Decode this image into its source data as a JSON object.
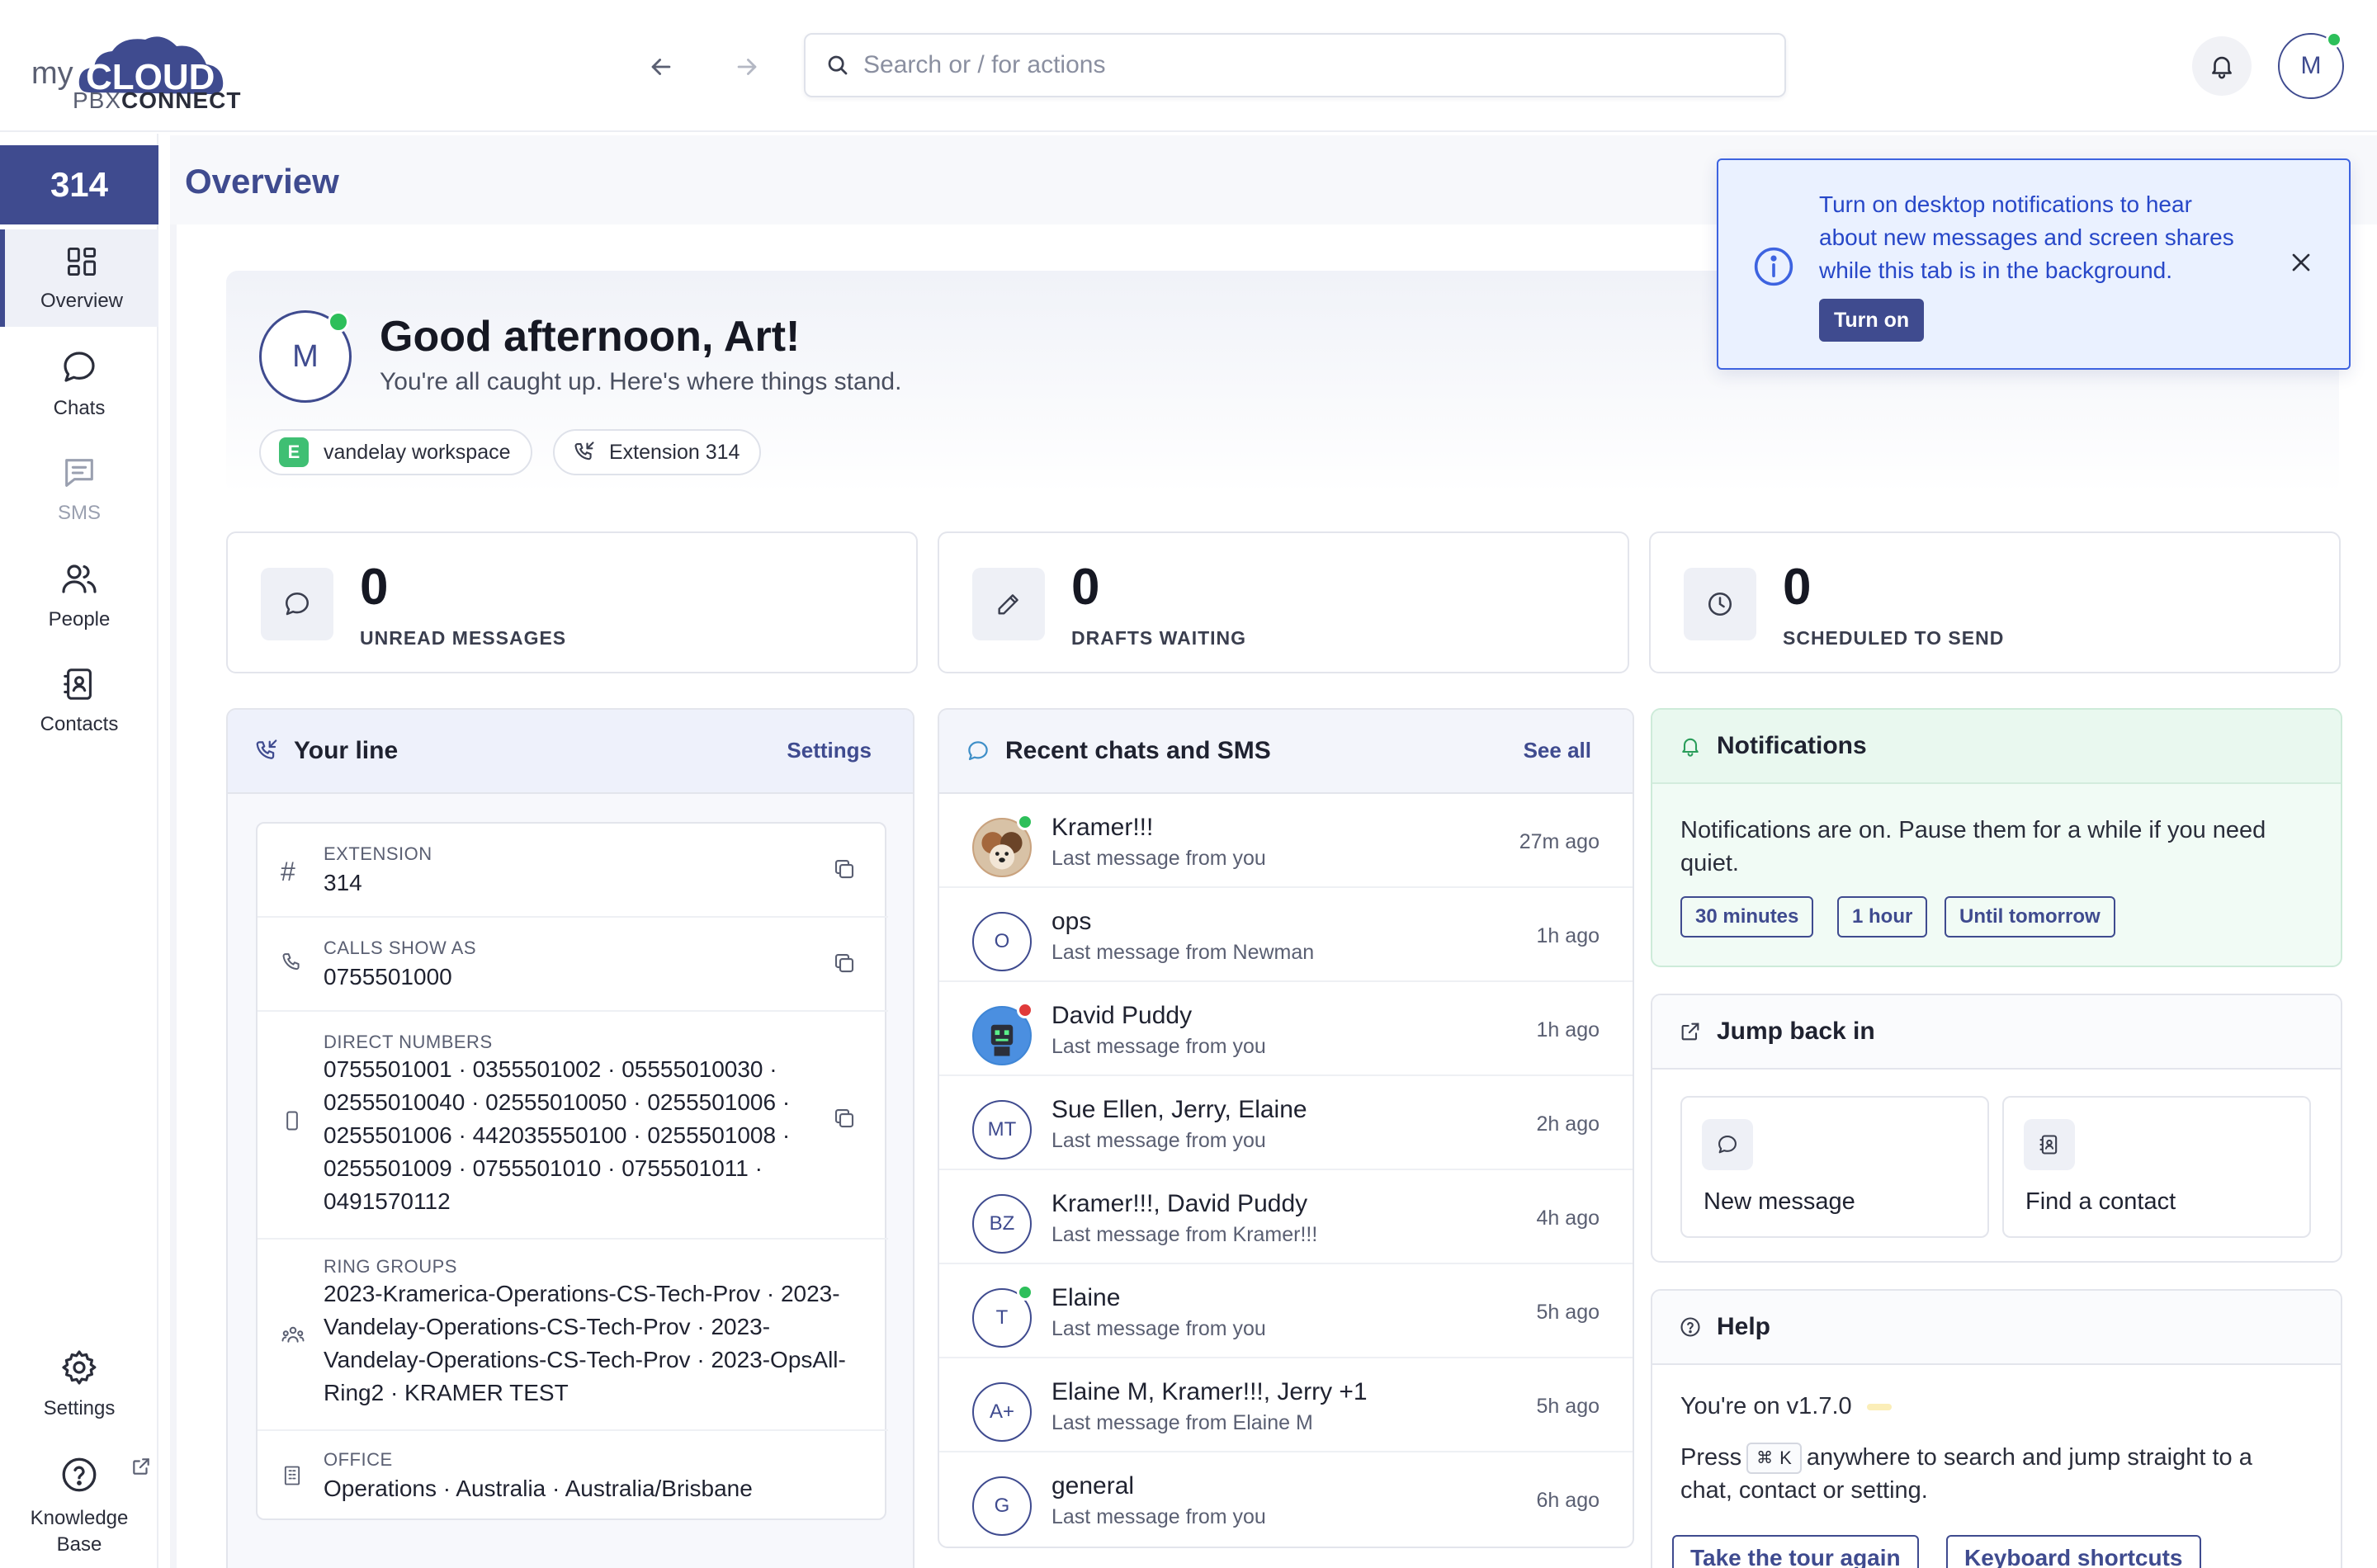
{
  "brand": {
    "my": "my",
    "cloud": "CLOUD",
    "pbx": "PBX",
    "connect": "CONNECT"
  },
  "search": {
    "placeholder": "Search or / for actions"
  },
  "user": {
    "initial": "M"
  },
  "sidebar": {
    "extension": "314",
    "items": [
      {
        "label": "Overview",
        "icon": "overview-grid-icon",
        "active": true
      },
      {
        "label": "Chats",
        "icon": "chat-bubble-icon"
      },
      {
        "label": "SMS",
        "icon": "sms-icon",
        "muted": true
      },
      {
        "label": "People",
        "icon": "people-icon"
      },
      {
        "label": "Contacts",
        "icon": "contacts-book-icon"
      }
    ],
    "bottom": [
      {
        "label": "Settings",
        "icon": "gear-icon"
      },
      {
        "label_line1": "Knowledge",
        "label_line2": "Base",
        "icon": "help-circle-icon"
      }
    ]
  },
  "page": {
    "title": "Overview"
  },
  "hero": {
    "greeting": "Good afternoon, Art!",
    "subtitle": "You're all caught up. Here's where things stand.",
    "workspace_initial": "E",
    "workspace": "vandelay workspace",
    "extension_chip": "Extension 314"
  },
  "stats": [
    {
      "value": "0",
      "label": "UNREAD MESSAGES",
      "icon": "chat-bubble-icon"
    },
    {
      "value": "0",
      "label": "DRAFTS WAITING",
      "icon": "pencil-icon"
    },
    {
      "value": "0",
      "label": "SCHEDULED TO SEND",
      "icon": "clock-icon"
    }
  ],
  "your_line": {
    "title": "Your line",
    "settings_link": "Settings",
    "extension_caption": "EXTENSION",
    "extension_value": "314",
    "calls_caption": "CALLS SHOW AS",
    "calls_value": "0755501000",
    "direct_caption": "DIRECT NUMBERS",
    "direct_lines": [
      "0755501001 · 0355501002 · 05555010030 ·",
      "02555010040 · 02555010050 · 0255501006 ·",
      "0255501006 · 442035550100 · 0255501008 ·",
      "0255501009 · 0755501010 · 0755501011 ·",
      "0491570112"
    ],
    "ring_caption": "RING GROUPS",
    "ring_lines": [
      "2023-Kramerica-Operations-CS-Tech-Prov · 2023-",
      "Vandelay-Operations-CS-Tech-Prov · 2023-",
      "Vandelay-Operations-CS-Tech-Prov · 2023-OpsAll-",
      "Ring2 · KRAMER TEST"
    ],
    "office_caption": "OFFICE",
    "office_value": "Operations · Australia · Australia/Brisbane"
  },
  "recent": {
    "title": "Recent chats and SMS",
    "see_all": "See all",
    "rows": [
      {
        "name": "Kramer!!!",
        "sub": "Last message from you",
        "time": "27m ago",
        "avatar": "",
        "status": "online"
      },
      {
        "name": "ops",
        "sub": "Last message from Newman",
        "time": "1h ago",
        "avatar": "O"
      },
      {
        "name": "David Puddy",
        "sub": "Last message from you",
        "time": "1h ago",
        "avatar": "",
        "status": "busy"
      },
      {
        "name": "Sue Ellen, Jerry, Elaine",
        "sub": "Last message from you",
        "time": "2h ago",
        "avatar": "MT"
      },
      {
        "name": "Kramer!!!, David Puddy",
        "sub": "Last message from Kramer!!!",
        "time": "4h ago",
        "avatar": "BZ"
      },
      {
        "name": "Elaine",
        "sub": "Last message from you",
        "time": "5h ago",
        "avatar": "T",
        "status": "online"
      },
      {
        "name": "Elaine M, Kramer!!!, Jerry +1",
        "sub": "Last message from Elaine M",
        "time": "5h ago",
        "avatar": "A+"
      },
      {
        "name": "general",
        "sub": "Last message from you",
        "time": "6h ago",
        "avatar": "G"
      }
    ]
  },
  "notifications": {
    "title": "Notifications",
    "text_line1": "Notifications are on. Pause them for a while if you need",
    "text_line2": "quiet.",
    "options": [
      "30 minutes",
      "1 hour",
      "Until tomorrow"
    ]
  },
  "jump": {
    "title": "Jump back in",
    "tiles": [
      {
        "label": "New message",
        "icon": "chat-bubble-icon"
      },
      {
        "label": "Find a contact",
        "icon": "contacts-book-icon"
      }
    ]
  },
  "help": {
    "title": "Help",
    "version": "You're on v1.7.0",
    "press": "Press",
    "key_symbol": "⌘",
    "key": "K",
    "press_rest": "anywhere to search and jump straight to a",
    "press_line2": "chat, contact or setting.",
    "buttons": [
      "Take the tour again",
      "Keyboard shortcuts"
    ]
  },
  "toast": {
    "line1": "Turn on desktop notifications to hear",
    "line2": "about new messages and screen shares",
    "line3": "while this tab is in the background.",
    "button": "Turn on"
  },
  "colors": {
    "primary": "#3f4b8f",
    "online": "#2dbf5a",
    "busy": "#e03a3a",
    "toast_border": "#3d63e0",
    "toast_text": "#2747c8"
  }
}
